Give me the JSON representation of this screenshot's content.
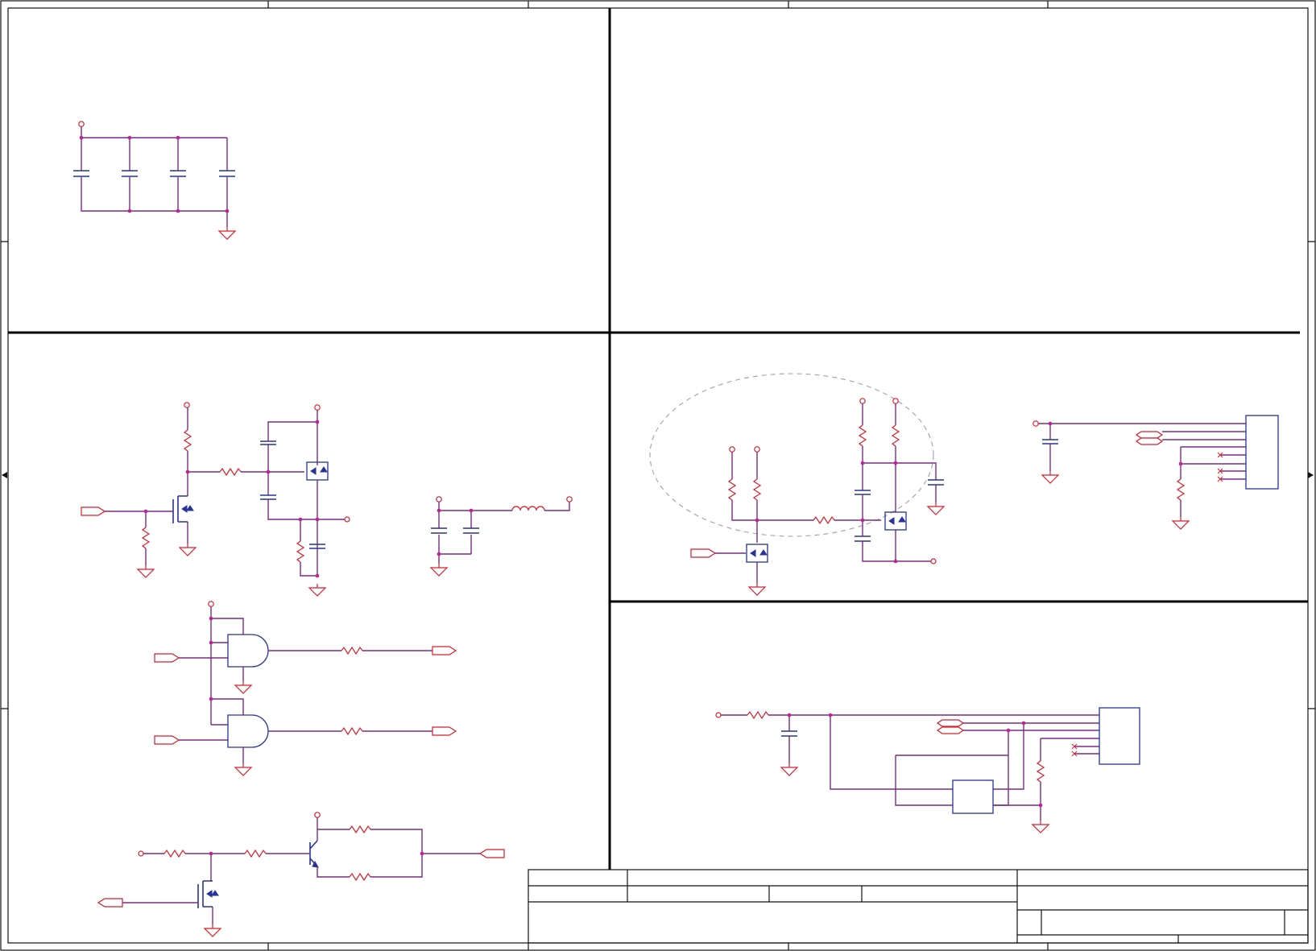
{
  "colors": {
    "wire": "#d81e2c",
    "component": "#27329a",
    "junction": "#c0209a",
    "divider": "#000000",
    "background": "#ffffff"
  }
}
